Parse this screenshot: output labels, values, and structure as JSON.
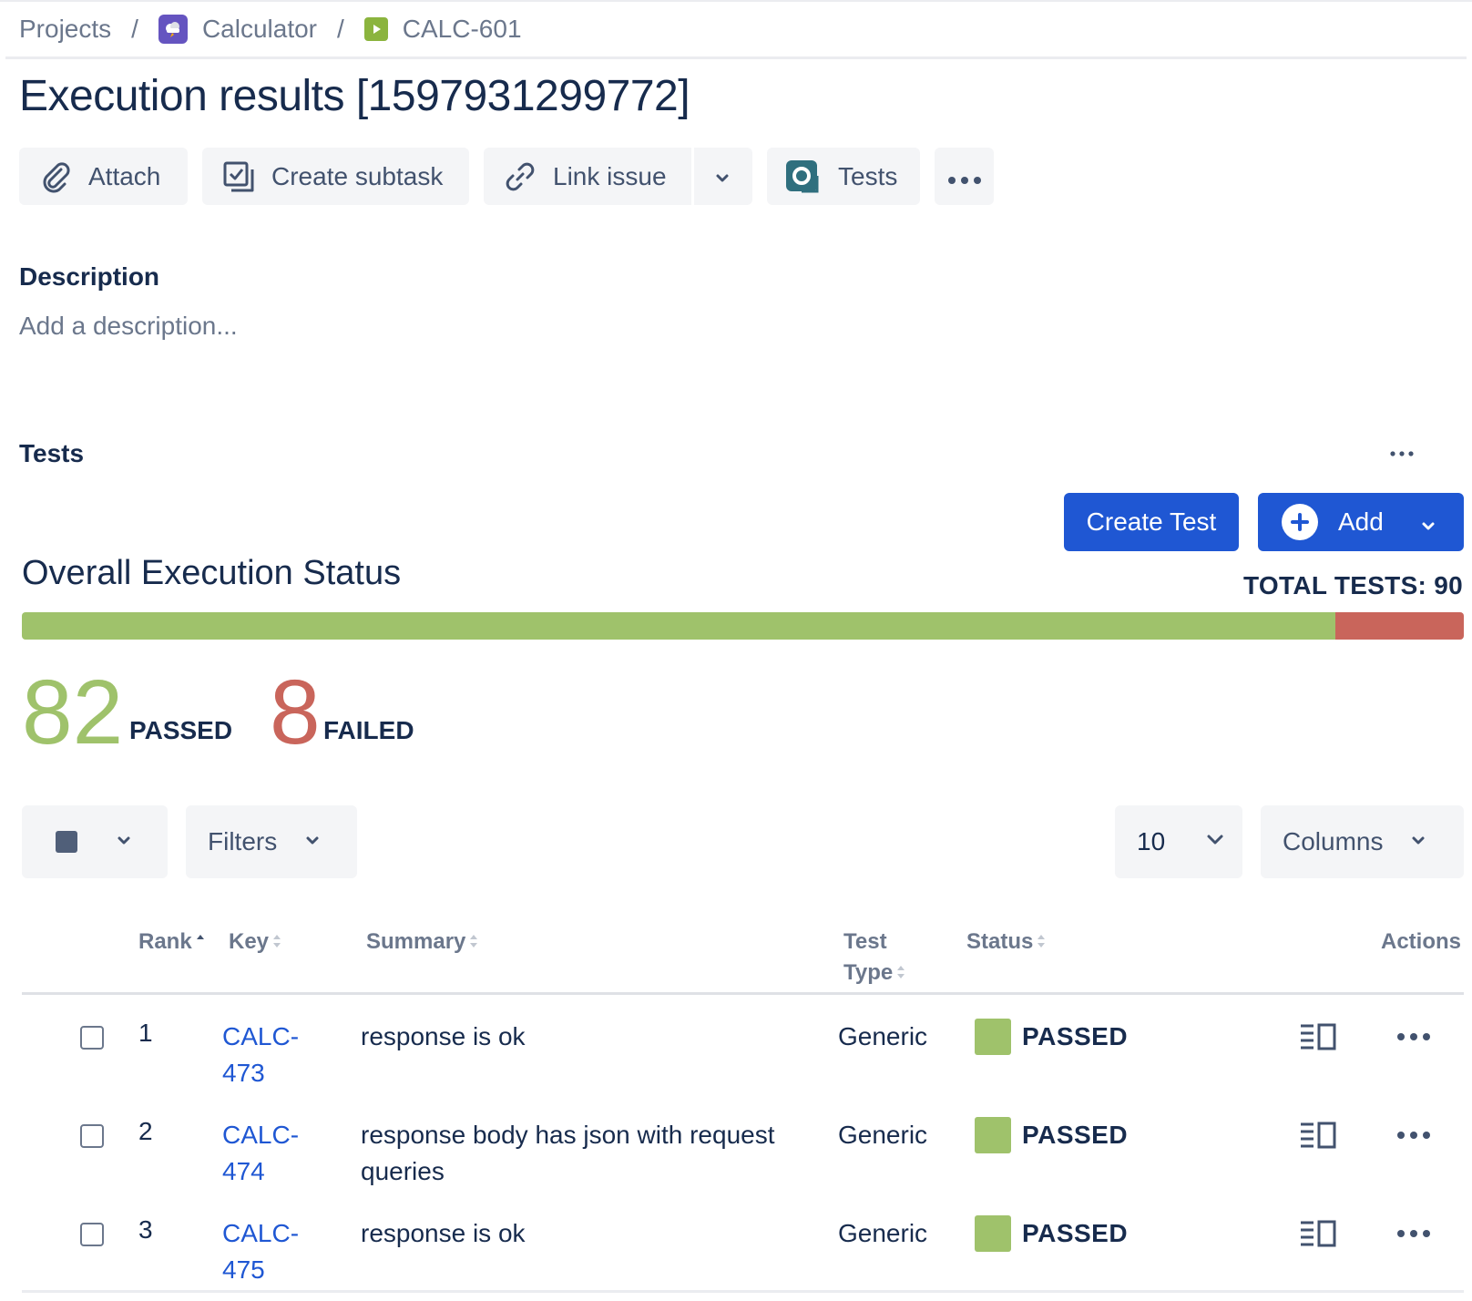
{
  "breadcrumb": {
    "projects": "Projects",
    "project": "Calculator",
    "issue_key": "CALC-601",
    "separator": "/"
  },
  "title": "Execution results [1597931299772]",
  "toolbar": {
    "attach": "Attach",
    "create_subtask": "Create subtask",
    "link_issue": "Link issue",
    "tests": "Tests"
  },
  "description": {
    "heading": "Description",
    "placeholder": "Add a description..."
  },
  "tests_section": {
    "heading": "Tests",
    "create_test": "Create Test",
    "add": "Add"
  },
  "overall": {
    "title": "Overall Execution Status",
    "total_label": "TOTAL TESTS: 90",
    "passed": 82,
    "failed": 8,
    "passed_display": "82",
    "failed_display": "8",
    "passed_label": "PASSED",
    "failed_label": "FAILED",
    "passed_color": "#9fc26b",
    "failed_color": "#c9655b"
  },
  "table_controls": {
    "filters": "Filters",
    "page_size": "10",
    "columns": "Columns"
  },
  "table": {
    "headers": {
      "rank": "Rank",
      "key": "Key",
      "summary": "Summary",
      "test_type_1": "Test",
      "test_type_2": "Type",
      "status": "Status",
      "actions": "Actions"
    },
    "rows": [
      {
        "rank": "1",
        "key": "CALC-473",
        "key_line1": "CALC-",
        "key_line2": "473",
        "summary": "response is ok",
        "type": "Generic",
        "status": "PASSED"
      },
      {
        "rank": "2",
        "key": "CALC-474",
        "key_line1": "CALC-",
        "key_line2": "474",
        "summary": "response body has json with request queries",
        "type": "Generic",
        "status": "PASSED"
      },
      {
        "rank": "3",
        "key": "CALC-475",
        "key_line1": "CALC-",
        "key_line2": "475",
        "summary": "response is ok",
        "type": "Generic",
        "status": "PASSED"
      }
    ]
  },
  "colors": {
    "primary": "#1f57d3",
    "link": "#1f57d3",
    "passed": "#9fc26b",
    "failed": "#c9655b"
  },
  "icons": [
    "project-avatar-icon",
    "test-execution-icon",
    "paperclip-icon",
    "subtask-icon",
    "link-icon",
    "chevron-down-icon",
    "tests-app-icon",
    "more-icon",
    "plus-icon",
    "detail-view-icon"
  ]
}
